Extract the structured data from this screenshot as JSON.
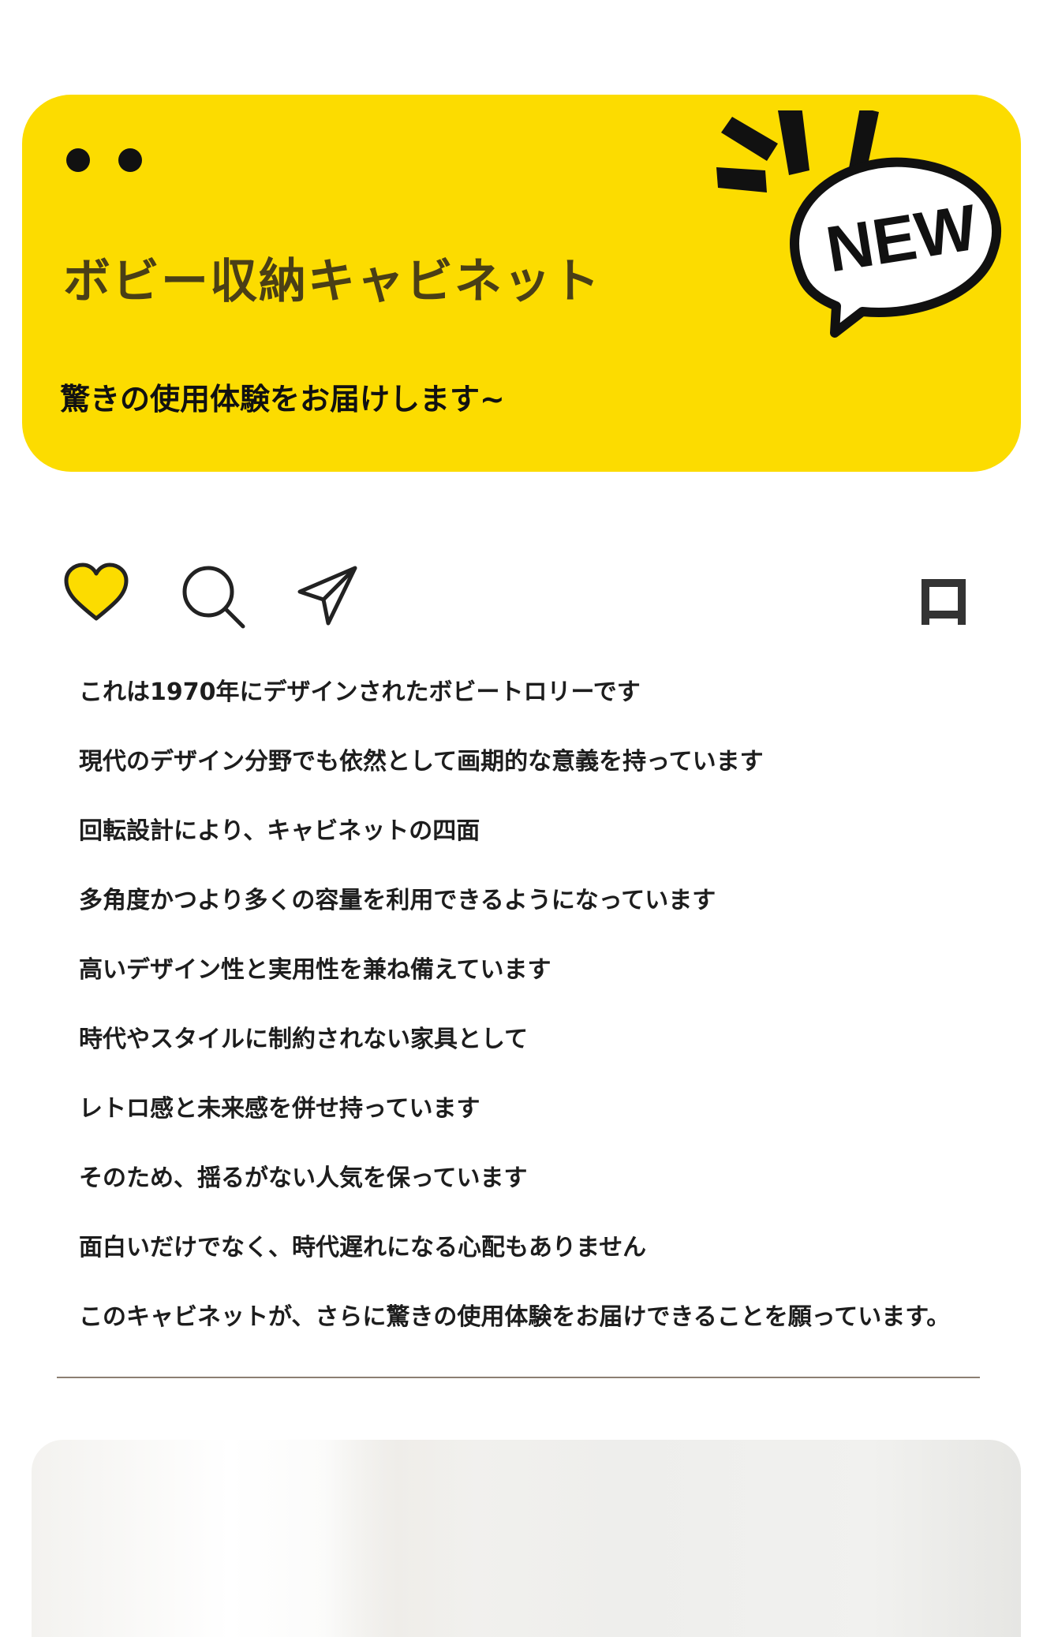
{
  "banner": {
    "title": "ボビー収納キャビネット",
    "subtitle": "驚きの使用体験をお届けします~",
    "badge": "NEW",
    "color": "#fcdc00"
  },
  "actions": {
    "like_icon": "heart-icon",
    "like_color": "#fcdc00",
    "search_icon": "search-icon",
    "share_icon": "send-icon",
    "save_icon": "bookmark-icon"
  },
  "description": {
    "lines": [
      "これは1970年にデザインされたボビートロリーです",
      "現代のデザイン分野でも依然として画期的な意義を持っています",
      "回転設計により、キャビネットの四面",
      "多角度かつより多くの容量を利用できるようになっています",
      "高いデザイン性と実用性を兼ね備えています",
      "時代やスタイルに制約されない家具として",
      "レトロ感と未来感を併せ持っています",
      "そのため、揺るがない人気を保っています",
      "面白いだけでなく、時代遅れになる心配もありません",
      "このキャビネットが、さらに驚きの使用体験をお届けできることを願っています。"
    ]
  }
}
